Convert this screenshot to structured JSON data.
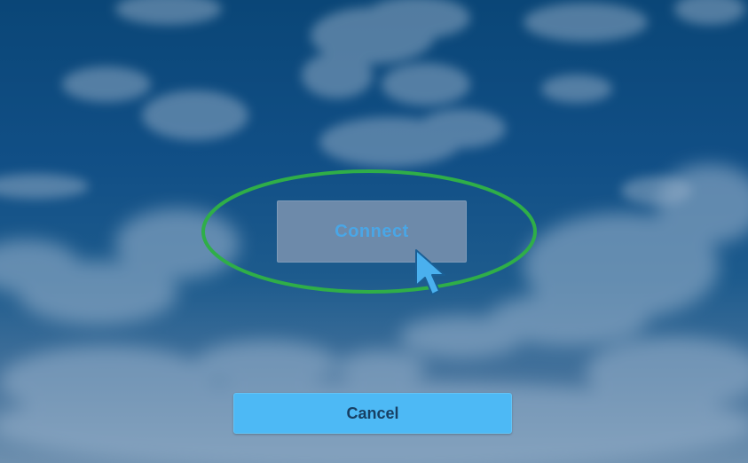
{
  "screen": {
    "background": "sky-with-clouds"
  },
  "connect_button": {
    "label": "Connect",
    "state": "disabled-looking / greyed",
    "text_color": "#4aa6e6",
    "bg_color": "#6d8aaa"
  },
  "highlight": {
    "shape": "ellipse",
    "color": "#2fae48",
    "target": "connect_button"
  },
  "cursor": {
    "icon": "mouse-pointer-icon",
    "color": "#4ab0ee"
  },
  "cancel_button": {
    "label": "Cancel",
    "text_color": "#173f63",
    "bg_color": "#4db9f5"
  }
}
